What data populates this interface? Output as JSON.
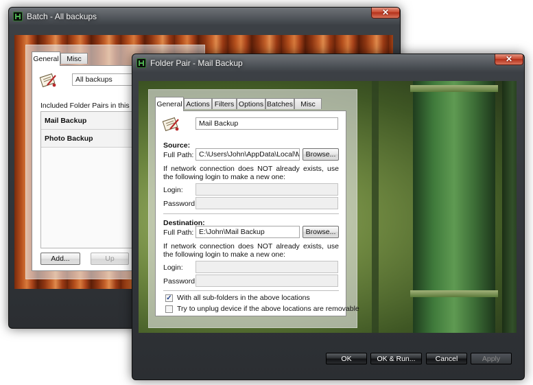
{
  "batch_window": {
    "title": "Batch - All backups",
    "close_glyph": "✕",
    "tabs": [
      {
        "label": "General",
        "active": true
      },
      {
        "label": "Misc",
        "active": false
      }
    ],
    "name_value": "All backups",
    "included_label": "Included Folder Pairs in this Batch",
    "folder_pairs": [
      "Mail Backup",
      "Photo Backup"
    ],
    "buttons": {
      "add": "Add...",
      "up": "Up"
    }
  },
  "folder_pair_window": {
    "title": "Folder Pair - Mail Backup",
    "close_glyph": "✕",
    "tabs": [
      {
        "label": "General",
        "active": true
      },
      {
        "label": "Actions",
        "active": false
      },
      {
        "label": "Filters",
        "active": false
      },
      {
        "label": "Options",
        "active": false
      },
      {
        "label": "Batches",
        "active": false
      },
      {
        "label": "Misc",
        "active": false
      }
    ],
    "name_value": "Mail Backup",
    "source": {
      "heading": "Source:",
      "full_path_label": "Full Path:",
      "full_path_value": "C:\\Users\\John\\AppData\\Local\\Micro",
      "browse_label": "Browse...",
      "network_note": "If network connection does NOT already exists, use the following login to make a new one:",
      "login_label": "Login:",
      "password_label": "Password:"
    },
    "destination": {
      "heading": "Destination:",
      "full_path_label": "Full Path:",
      "full_path_value": "E:\\John\\Mail Backup",
      "browse_label": "Browse...",
      "network_note": "If network connection does NOT already exists, use the following login to make a new one:",
      "login_label": "Login:",
      "password_label": "Password:"
    },
    "checkboxes": [
      {
        "label": "With all sub-folders in the above locations",
        "checked": true,
        "mark": "✓"
      },
      {
        "label": "Try to unplug device if the above locations are removable",
        "checked": false,
        "mark": ""
      }
    ],
    "buttons": {
      "ok": "OK",
      "ok_run": "OK & Run...",
      "cancel": "Cancel",
      "apply": "Apply"
    }
  },
  "icons": [
    "app-icon",
    "folder-pair-icon",
    "close-icon",
    "checkmark-icon"
  ],
  "colors": {
    "title_text": "#f2f2f2",
    "close_red": "#c8482f",
    "window_frame": "#2b2e32",
    "glass_panel": "#e4e4e4",
    "wood_background": "#b6501d",
    "bamboo_background": "#6e8740"
  }
}
